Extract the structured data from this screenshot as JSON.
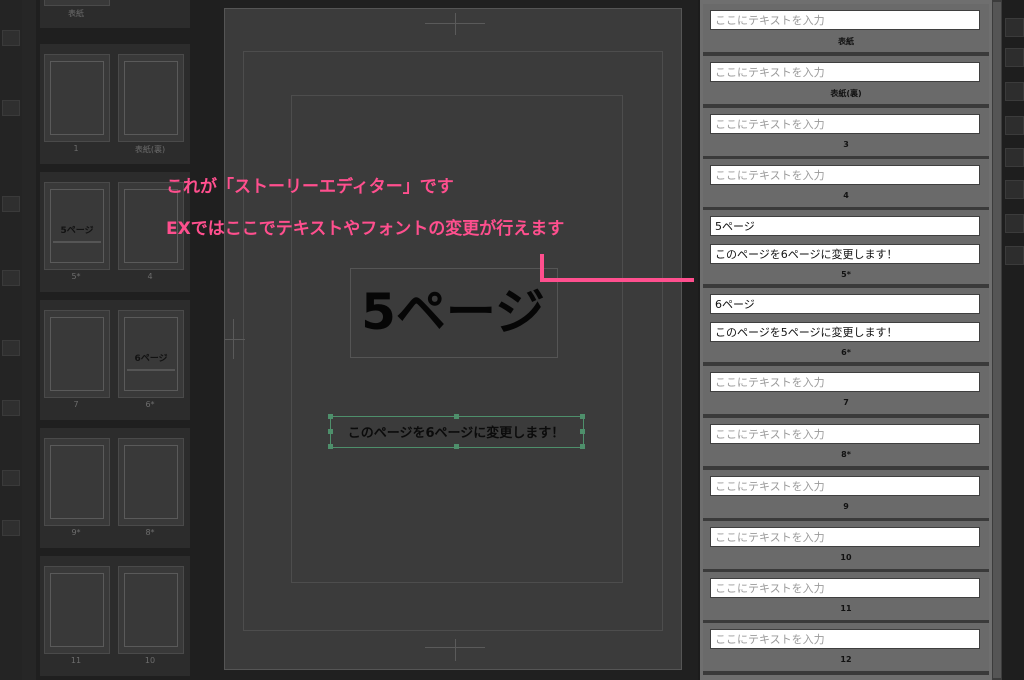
{
  "page_manager": {
    "spreads": [
      {
        "left": {
          "title": "",
          "label": "表紙"
        },
        "right": null
      },
      {
        "left": {
          "title": "",
          "label": "1"
        },
        "right": {
          "title": "",
          "label": "表紙(裏)"
        }
      },
      {
        "left": {
          "title": "5ページ",
          "label": "5*"
        },
        "right": {
          "title": "",
          "label": "4"
        }
      },
      {
        "left": {
          "title": "",
          "label": "7"
        },
        "right": {
          "title": "6ページ",
          "label": "6*"
        }
      },
      {
        "left": {
          "title": "",
          "label": "9*"
        },
        "right": {
          "title": "",
          "label": "8*"
        }
      },
      {
        "left": {
          "title": "",
          "label": "11"
        },
        "right": {
          "title": "",
          "label": "10"
        }
      }
    ]
  },
  "canvas": {
    "title": "5ページ",
    "subtitle": "このページを6ページに変更します！"
  },
  "annotation": {
    "line1": "これが「ストーリーエディター」です",
    "line2": "EXではここでテキストやフォントの変更が行えます"
  },
  "story_editor": {
    "placeholder": "ここにテキストを入力",
    "entries": [
      {
        "fields": [
          "ここにテキストを入力"
        ],
        "filled": false,
        "label": "表紙"
      },
      {
        "fields": [
          "ここにテキストを入力"
        ],
        "filled": false,
        "label": "表紙(裏)"
      },
      {
        "fields": [
          "ここにテキストを入力"
        ],
        "filled": false,
        "label": "3"
      },
      {
        "fields": [
          "ここにテキストを入力"
        ],
        "filled": false,
        "label": "4"
      },
      {
        "fields": [
          "5ページ",
          "このページを6ページに変更します！"
        ],
        "filled": true,
        "label": "5*"
      },
      {
        "fields": [
          "6ページ",
          "このページを5ページに変更します！"
        ],
        "filled": true,
        "label": "6*"
      },
      {
        "fields": [
          "ここにテキストを入力"
        ],
        "filled": false,
        "label": "7"
      },
      {
        "fields": [
          "ここにテキストを入力"
        ],
        "filled": false,
        "label": "8*"
      },
      {
        "fields": [
          "ここにテキストを入力"
        ],
        "filled": false,
        "label": "9"
      },
      {
        "fields": [
          "ここにテキストを入力"
        ],
        "filled": false,
        "label": "10"
      },
      {
        "fields": [
          "ここにテキストを入力"
        ],
        "filled": false,
        "label": "11"
      },
      {
        "fields": [
          "ここにテキストを入力"
        ],
        "filled": false,
        "label": "12"
      }
    ]
  },
  "colors": {
    "annotation": "#ff4f8e",
    "selection": "#4e8f6b",
    "panel": "#6f6f6f"
  }
}
